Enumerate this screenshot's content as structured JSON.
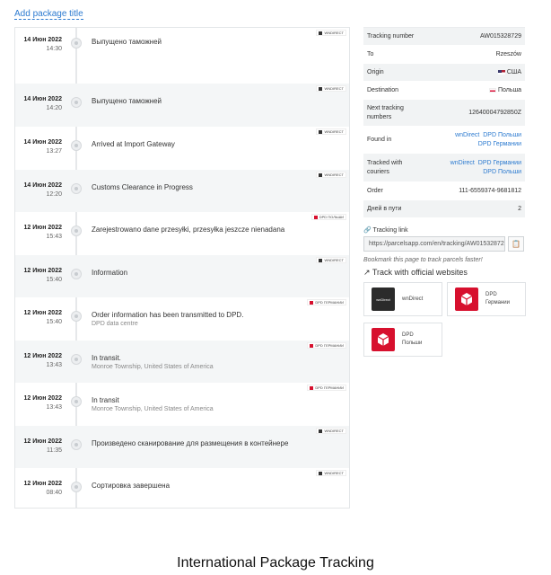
{
  "header": {
    "add_title": "Add package title"
  },
  "events": [
    {
      "date": "14 Июн 2022",
      "time": "14:30",
      "text": "Выпущено таможней",
      "sub": "",
      "carrier": "WNDIRECT",
      "carrier_icon": "wndirect-logo-icon"
    },
    {
      "date": "14 Июн 2022",
      "time": "14:20",
      "text": "Выпущено таможней",
      "sub": "",
      "carrier": "WNDIRECT",
      "carrier_icon": "wndirect-logo-icon"
    },
    {
      "date": "14 Июн 2022",
      "time": "13:27",
      "text": "Arrived at Import Gateway",
      "sub": "",
      "carrier": "WNDIRECT",
      "carrier_icon": "wndirect-logo-icon"
    },
    {
      "date": "14 Июн 2022",
      "time": "12:20",
      "text": "Customs Clearance in Progress",
      "sub": "",
      "carrier": "WNDIRECT",
      "carrier_icon": "wndirect-logo-icon"
    },
    {
      "date": "12 Июн 2022",
      "time": "15:43",
      "text": "Zarejestrowano dane przesyłki, przesyłka jeszcze nienadana",
      "sub": "",
      "carrier": "DPD ПОЛЬШИ",
      "carrier_icon": "dpd-logo-icon"
    },
    {
      "date": "12 Июн 2022",
      "time": "15:40",
      "text": "Information",
      "sub": "",
      "carrier": "WNDIRECT",
      "carrier_icon": "wndirect-logo-icon"
    },
    {
      "date": "12 Июн 2022",
      "time": "15:40",
      "text": "Order information has been transmitted to DPD.",
      "sub": "DPD data centre",
      "carrier": "DPD ГЕРМАНИИ",
      "carrier_icon": "dpd-logo-icon"
    },
    {
      "date": "12 Июн 2022",
      "time": "13:43",
      "text": "In transit.",
      "sub": "Monroe Township, United States of America",
      "carrier": "DPD ГЕРМАНИИ",
      "carrier_icon": "dpd-logo-icon"
    },
    {
      "date": "12 Июн 2022",
      "time": "13:43",
      "text": "In transit",
      "sub": "Monroe Township, United States of America",
      "carrier": "DPD ГЕРМАНИИ",
      "carrier_icon": "dpd-logo-icon"
    },
    {
      "date": "12 Июн 2022",
      "time": "11:35",
      "text": "Произведено сканирование для размещения в контейнере",
      "sub": "",
      "carrier": "WNDIRECT",
      "carrier_icon": "wndirect-logo-icon"
    },
    {
      "date": "12 Июн 2022",
      "time": "08:40",
      "text": "Сортировка завершена",
      "sub": "",
      "carrier": "WNDIRECT",
      "carrier_icon": "wndirect-logo-icon"
    }
  ],
  "info": {
    "tracking_number_label": "Tracking number",
    "tracking_number": "AW015328729",
    "to_label": "To",
    "to": "Rzeszów",
    "origin_label": "Origin",
    "origin": "США",
    "destination_label": "Destination",
    "destination": "Польша",
    "next_label": "Next tracking numbers",
    "next": "12640004792850Z",
    "found_label": "Found in",
    "found": [
      "wnDirect",
      "DPD Польши",
      "DPD Германии"
    ],
    "tracked_label": "Tracked with couriers",
    "tracked": [
      "wnDirect",
      "DPD Германии",
      "DPD Польши"
    ],
    "order_label": "Order",
    "order": "111-6559374-9681812",
    "days_label": "Дней в пути",
    "days": "2"
  },
  "tracking_link": {
    "label": "Tracking link",
    "url": "https://parcelsapp.com/en/tracking/AW015328729",
    "bookmark_note": "Bookmark this page to track parcels faster!",
    "official_title": "Track with official websites"
  },
  "couriers": [
    {
      "name": "wnDirect",
      "logo_text": "wnDirect",
      "icon": "wndirect-logo-icon"
    },
    {
      "name": "DPD\nГермании",
      "icon": "dpd-logo-icon"
    },
    {
      "name": "DPD\nПольши",
      "icon": "dpd-logo-icon"
    }
  ],
  "footer": {
    "title": "International Package Tracking"
  },
  "colors": {
    "link": "#2d7bd0",
    "dpd_red": "#d7102e",
    "row_alt": "#f4f6f7"
  }
}
